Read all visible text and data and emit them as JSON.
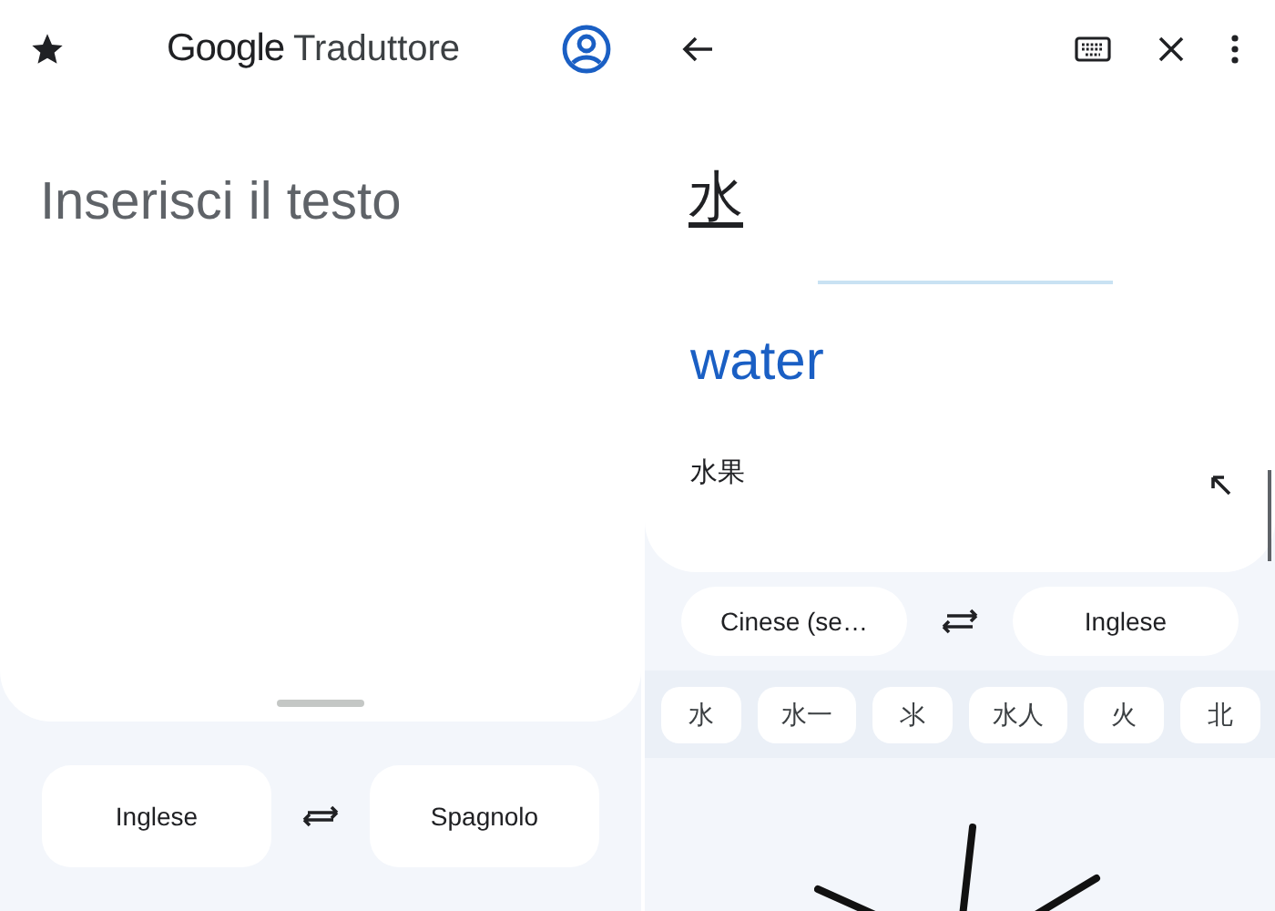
{
  "left": {
    "brand": "Google",
    "title": "Traduttore",
    "input": {
      "placeholder": "Inserisci il testo"
    },
    "languages": {
      "source": "Inglese",
      "target": "Spagnolo"
    }
  },
  "right": {
    "source_text": "水",
    "translation": "water",
    "suggestion": "水果",
    "languages": {
      "source": "Cinese (se…",
      "target": "Inglese"
    },
    "candidates": [
      "水",
      "水一",
      "氺",
      "水人",
      "火",
      "北"
    ]
  }
}
